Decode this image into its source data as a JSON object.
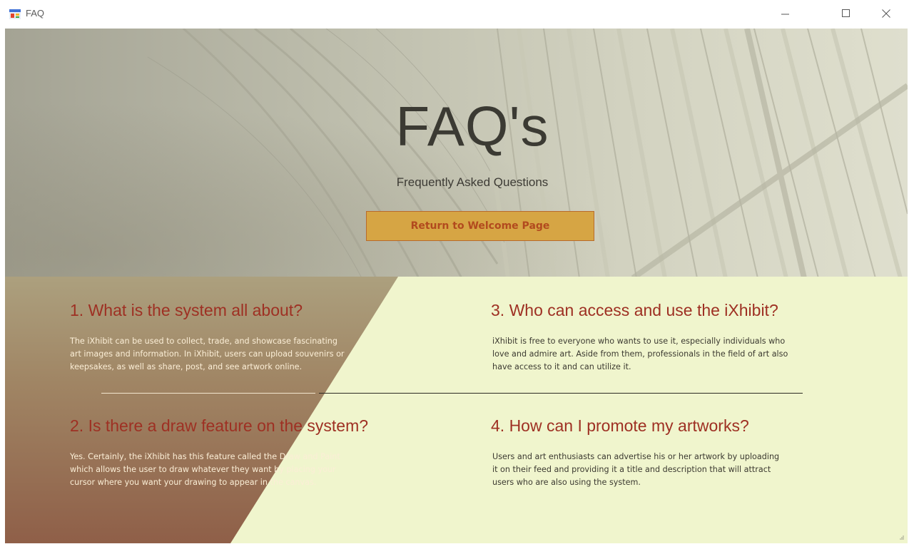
{
  "window": {
    "title": "FAQ",
    "icon": "app-form-icon",
    "controls": [
      "minimize-icon",
      "maximize-icon",
      "close-icon"
    ]
  },
  "hero": {
    "title": "FAQ's",
    "subtitle": "Frequently Asked Questions",
    "return_button_label": "Return to Welcome Page"
  },
  "faq": [
    {
      "question": "1. What is the system all about?",
      "answer": "The iXhibit can be used to collect, trade, and showcase fascinating\nart images and information. In iXhibit, users can upload souvenirs or\nkeepsakes, as well as share, post, and see artwork online."
    },
    {
      "question": "2. Is there a draw feature on the system?",
      "answer": "Yes. Certainly, the iXhibit has this feature called the Draw and Paint\nwhich allows the user to draw whatever they want by placing your\ncursor where you want your drawing to appear in the canvas."
    },
    {
      "question": "3. Who can access and use the iXhibit?",
      "answer": "iXhibit is free to everyone who wants to use it, especially individuals who\nlove and admire art. Aside from them, professionals in the field of art also\nhave access to it and can utilize it."
    },
    {
      "question": "4. How can I promote my artworks?",
      "answer": "Users and art enthusiasts can advertise his or her artwork by uploading\nit on their feed and providing it a title and description that will attract\nusers who are also using the system."
    }
  ],
  "colors": {
    "accent_button": "#d6a544",
    "button_text": "#b24a1e",
    "question_title": "#9e3023",
    "lower_panel": "#f0f5cd"
  }
}
